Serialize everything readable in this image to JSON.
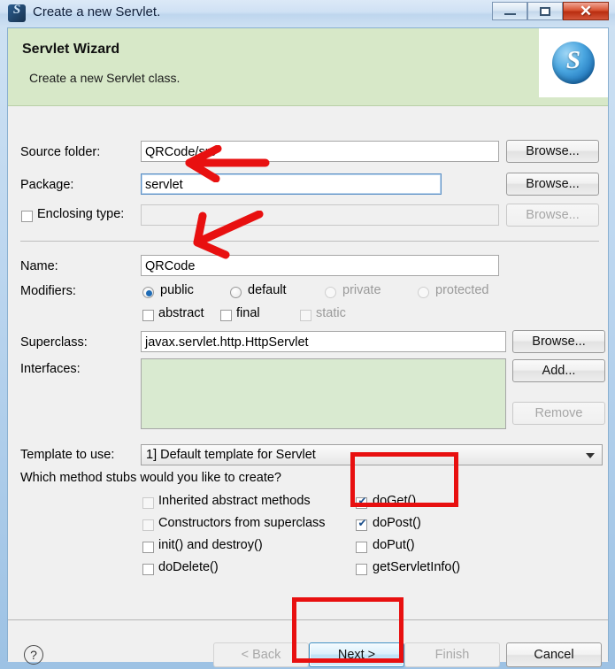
{
  "window": {
    "title": "Create a new Servlet.",
    "icon": "servlet-app-icon",
    "icon_glyph": "S",
    "controls": {
      "minimize": "minimize-icon",
      "maximize": "maximize-icon",
      "close": "✕"
    }
  },
  "header": {
    "title": "Servlet Wizard",
    "subtitle": "Create a new Servlet class.",
    "logo_glyph": "S",
    "background_color": "#d7e8c8"
  },
  "form": {
    "source_folder": {
      "label": "Source folder:",
      "value": "QRCode/src",
      "browse": "Browse...",
      "enabled": true
    },
    "package": {
      "label": "Package:",
      "value": "servlet",
      "browse": "Browse...",
      "enabled": true,
      "focused": true
    },
    "enclosing_type": {
      "label": "Enclosing type:",
      "value": "",
      "browse": "Browse...",
      "enabled": false,
      "checked": false
    },
    "name": {
      "label": "Name:",
      "value": "QRCode"
    },
    "modifiers": {
      "label": "Modifiers:",
      "radios": [
        {
          "label": "public",
          "selected": true,
          "enabled": true
        },
        {
          "label": "default",
          "selected": false,
          "enabled": true
        },
        {
          "label": "private",
          "selected": false,
          "enabled": false
        },
        {
          "label": "protected",
          "selected": false,
          "enabled": false
        }
      ],
      "checkboxes": [
        {
          "label": "abstract",
          "checked": false,
          "enabled": true
        },
        {
          "label": "final",
          "checked": false,
          "enabled": true
        },
        {
          "label": "static",
          "checked": false,
          "enabled": false
        }
      ]
    },
    "superclass": {
      "label": "Superclass:",
      "value": "javax.servlet.http.HttpServlet",
      "browse": "Browse..."
    },
    "interfaces": {
      "label": "Interfaces:",
      "items": [],
      "add": "Add...",
      "remove": "Remove",
      "remove_enabled": false
    },
    "template": {
      "label": "Template to use:",
      "value": "1] Default template for Servlet"
    },
    "stubs": {
      "question": "Which method stubs would you like to create?",
      "left": [
        {
          "label": "Inherited abstract methods",
          "checked": false,
          "enabled": false
        },
        {
          "label": "Constructors from superclass",
          "checked": false,
          "enabled": false
        },
        {
          "label": "init() and destroy()",
          "checked": false,
          "enabled": true
        },
        {
          "label": "doDelete()",
          "checked": false,
          "enabled": true
        }
      ],
      "right": [
        {
          "label": "doGet()",
          "checked": true,
          "enabled": true
        },
        {
          "label": "doPost()",
          "checked": true,
          "enabled": true
        },
        {
          "label": "doPut()",
          "checked": false,
          "enabled": true
        },
        {
          "label": "getServletInfo()",
          "checked": false,
          "enabled": true
        }
      ]
    }
  },
  "buttons": {
    "help": "?",
    "back": {
      "label": "< Back",
      "enabled": false
    },
    "next": {
      "label": "Next >",
      "enabled": true,
      "primary": true
    },
    "finish": {
      "label": "Finish",
      "enabled": false
    },
    "cancel": {
      "label": "Cancel",
      "enabled": true
    }
  },
  "annotations": {
    "color": "#e81010",
    "arrow_package": "left-arrow-pointing-at-package-field",
    "arrow_name": "diagonal-arrow-pointing-at-name-field",
    "rect_stubs": "red-rectangle-around-doget-dopost",
    "rect_next": "red-rectangle-around-next-button"
  }
}
